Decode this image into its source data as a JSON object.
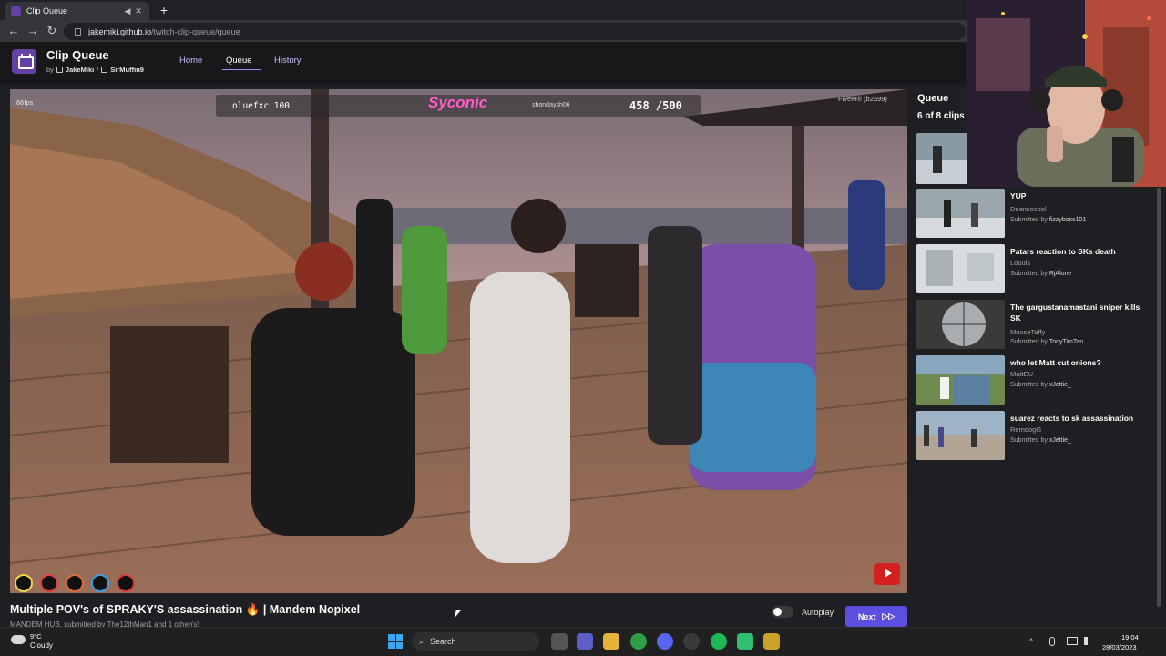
{
  "browser": {
    "tab_title": "Clip Queue",
    "tab_mute": "◀",
    "tab_close": "✕",
    "new_tab": "+",
    "back": "←",
    "forward": "→",
    "reload": "↻",
    "url_host": "jakemiki.github.io",
    "url_path": "/twitch-clip-queue/queue"
  },
  "app": {
    "title": "Clip Queue",
    "by_label": "by",
    "author": "JakeMiki",
    "separator": "/",
    "channel": "SirMuffin9",
    "nav": [
      "Home",
      "Queue",
      "History"
    ],
    "active_nav": "Queue"
  },
  "player": {
    "fps": "66fps",
    "hud_player": "oluefxc 100",
    "hud_logo": "Syconic",
    "hud_name": "shondaysh06",
    "hud_count": "458  /500",
    "hud_server": "FiveM® (b2699)"
  },
  "clip": {
    "title": "Multiple POV's of SPRAKY'S assassination 🔥 | Mandem Nopixel",
    "meta": "MANDEM HUB, submitted by The12thMan1 and 1 other(s)"
  },
  "controls": {
    "autoplay_label": "Autoplay",
    "autoplay_on": false,
    "next_label": "Next",
    "next_icon": "▷▷"
  },
  "queue": {
    "heading": "Queue",
    "count": "6 of 8 clips",
    "items": [
      {
        "title": "YUP",
        "channel": "Deansocool",
        "submitted_prefix": "Submitted by",
        "submitter": "fizzyboss101"
      },
      {
        "title": "Patars reaction to SKs death",
        "channel": "Louuis",
        "submitted_prefix": "Submitted by",
        "submitter": "RjAlone"
      },
      {
        "title": "The gargustanamastani sniper kills SK",
        "channel": "MooseTaffy",
        "submitted_prefix": "Submitted by",
        "submitter": "TonyTimTan"
      },
      {
        "title": "who let Matt cut onions?",
        "channel": "MattEU",
        "submitted_prefix": "Submitted by",
        "submitter": "xJettie_"
      },
      {
        "title": "suarez reacts to sk assassination",
        "channel": "RemdogG",
        "submitted_prefix": "Submitted by",
        "submitter": "xJettie_"
      }
    ]
  },
  "taskbar": {
    "weather_temp": "9°C",
    "weather_desc": "Cloudy",
    "search_placeholder": "Search",
    "time": "19:04",
    "date": "28/03/2023",
    "tray_chevron": "^"
  },
  "colors": {
    "accent": "#5c4fe0",
    "brand": "#6441a5",
    "header_bg": "#18181b",
    "page_bg": "#1e1f22"
  }
}
